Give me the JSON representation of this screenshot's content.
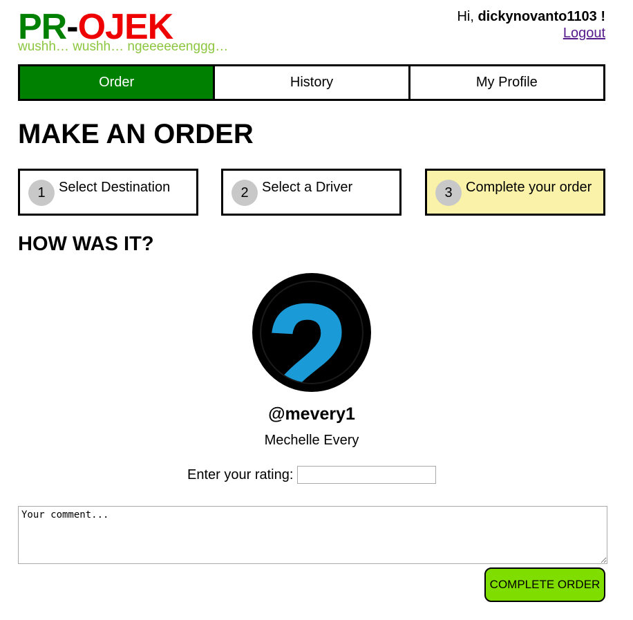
{
  "header": {
    "logo": {
      "part1": "PR",
      "dash": "-",
      "part2": "OJEK"
    },
    "tagline": "wushh… wushh… ngeeeeeenggg…",
    "greeting": "Hi,",
    "username": "dickynovanto1103",
    "exclaim": " !",
    "logout_label": "Logout"
  },
  "nav": {
    "tabs": [
      {
        "label": "Order",
        "active": true
      },
      {
        "label": "History",
        "active": false
      },
      {
        "label": "My Profile",
        "active": false
      }
    ]
  },
  "main": {
    "title": "MAKE AN ORDER",
    "steps": [
      {
        "number": "1",
        "label": "Select Destination"
      },
      {
        "number": "2",
        "label": "Select a Driver"
      },
      {
        "number": "3",
        "label": "Complete your order",
        "current": true
      }
    ],
    "section_title": "HOW WAS IT?"
  },
  "driver": {
    "avatar_icon": "number-2-avatar-icon",
    "avatar_text": "2",
    "username": "@mevery1",
    "name": "Mechelle Every"
  },
  "form": {
    "rating_label": "Enter your rating:",
    "rating_value": "",
    "comment_placeholder": "Your comment...",
    "complete_label": "COMPLETE ORDER"
  },
  "colors": {
    "brand_green": "#008000",
    "brand_red": "#ee0000",
    "tagline_green": "#8cc63f",
    "current_step_bg": "#f9f2a8",
    "button_green": "#7fdd00",
    "avatar_blue": "#1a9ad6"
  }
}
